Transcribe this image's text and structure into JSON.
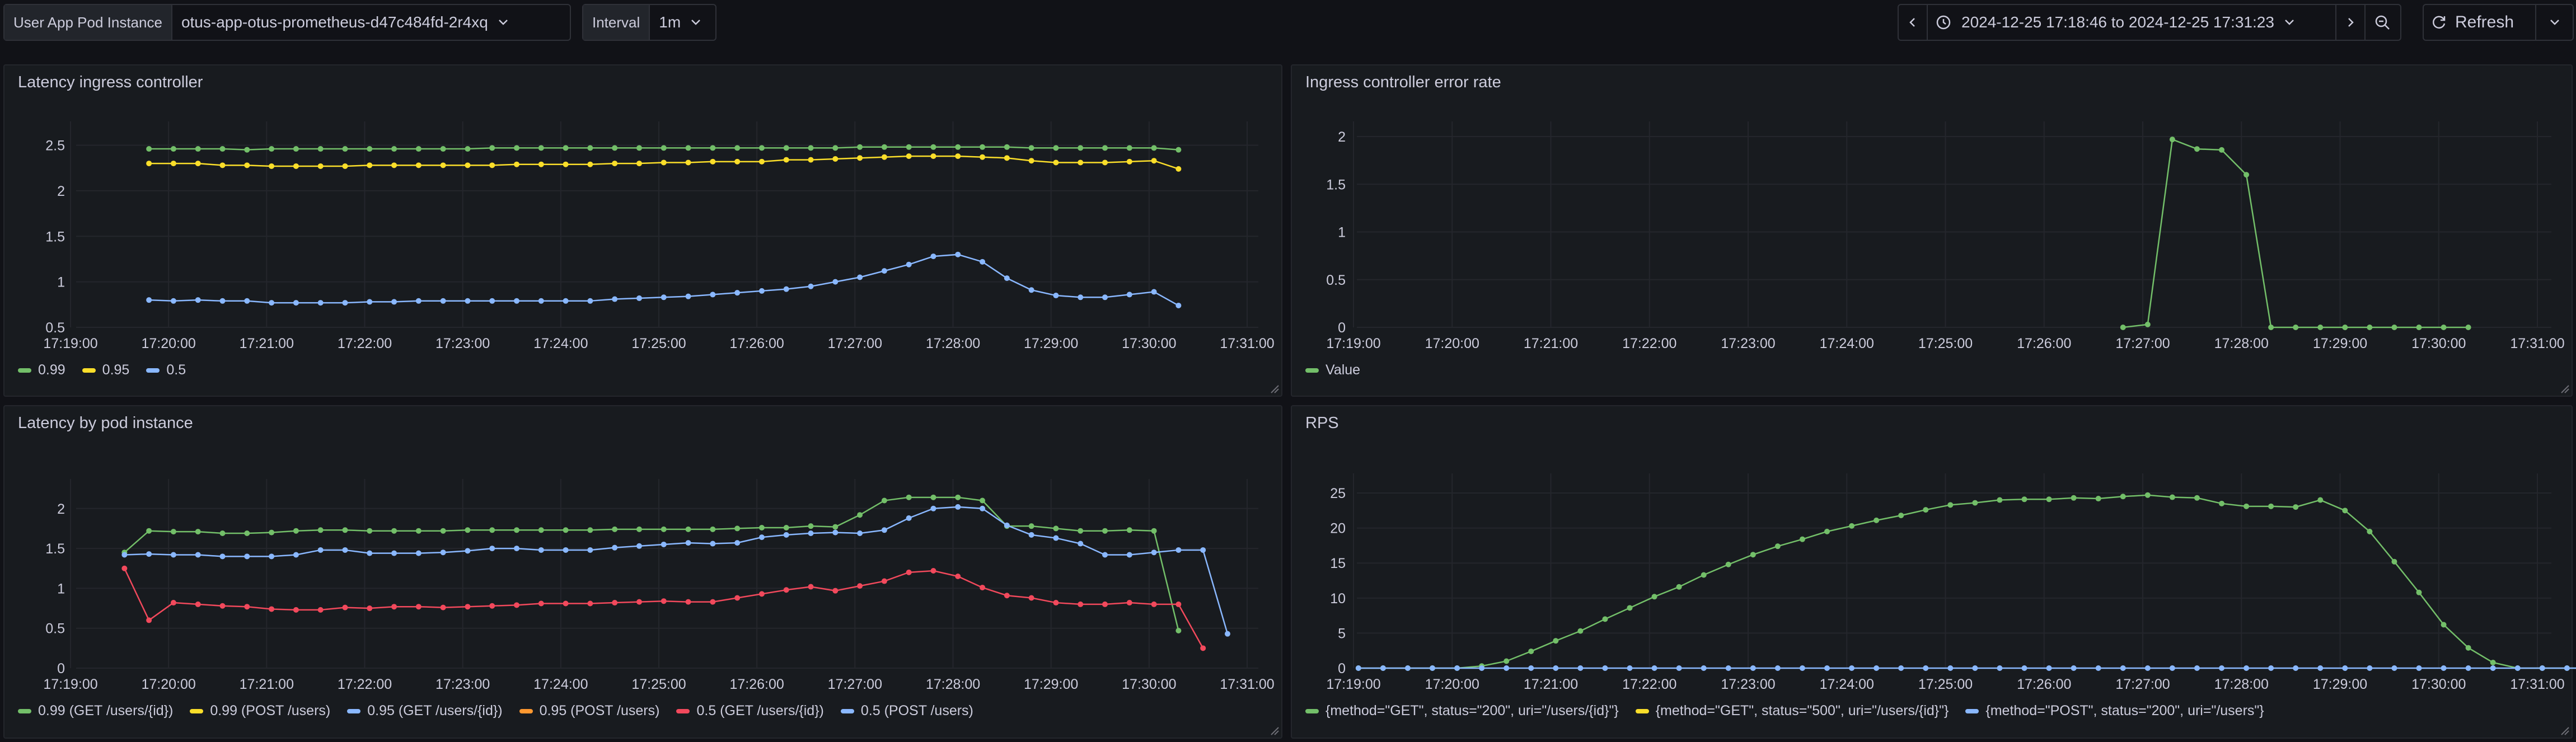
{
  "variables": {
    "pod_label": "User App Pod Instance",
    "pod_value": "otus-app-otus-prometheus-d47c484fd-2r4xq",
    "interval_label": "Interval",
    "interval_value": "1m"
  },
  "time_range": {
    "text": "2024-12-25 17:18:46 to 2024-12-25 17:31:23",
    "refresh_label": "Refresh"
  },
  "colors": {
    "green": "#73bf69",
    "yellow": "#fade2a",
    "blue": "#8ab8ff",
    "orange": "#ff9830",
    "red": "#f2495c"
  },
  "panels": {
    "latency_ingress": {
      "title": "Latency ingress controller"
    },
    "error_rate": {
      "title": "Ingress controller error rate"
    },
    "latency_pod": {
      "title": "Latency by pod instance"
    },
    "rps": {
      "title": "RPS"
    }
  },
  "chart_data": [
    {
      "type": "line",
      "title": "Latency ingress controller",
      "x_ticks": [
        "17:19:00",
        "17:20:00",
        "17:21:00",
        "17:22:00",
        "17:23:00",
        "17:24:00",
        "17:25:00",
        "17:26:00",
        "17:27:00",
        "17:28:00",
        "17:29:00",
        "17:30:00",
        "17:31:00"
      ],
      "y_ticks": [
        "0.5",
        "1",
        "1.5",
        "2",
        "2.5"
      ],
      "ylim": [
        0.5,
        2.7
      ],
      "x_start": "17:19:48",
      "x_step_seconds": 15,
      "series": [
        {
          "name": "0.99",
          "color": "#73bf69",
          "values": [
            2.46,
            2.46,
            2.46,
            2.46,
            2.45,
            2.46,
            2.46,
            2.46,
            2.46,
            2.46,
            2.46,
            2.46,
            2.46,
            2.46,
            2.47,
            2.47,
            2.47,
            2.47,
            2.47,
            2.47,
            2.47,
            2.47,
            2.47,
            2.47,
            2.47,
            2.47,
            2.47,
            2.47,
            2.47,
            2.48,
            2.48,
            2.48,
            2.48,
            2.48,
            2.48,
            2.48,
            2.47,
            2.47,
            2.47,
            2.47,
            2.47,
            2.47,
            2.45
          ]
        },
        {
          "name": "0.95",
          "color": "#fade2a",
          "values": [
            2.3,
            2.3,
            2.3,
            2.28,
            2.28,
            2.27,
            2.27,
            2.27,
            2.27,
            2.28,
            2.28,
            2.28,
            2.28,
            2.28,
            2.28,
            2.29,
            2.29,
            2.29,
            2.29,
            2.3,
            2.3,
            2.31,
            2.31,
            2.32,
            2.32,
            2.32,
            2.34,
            2.34,
            2.35,
            2.36,
            2.37,
            2.38,
            2.38,
            2.38,
            2.37,
            2.36,
            2.33,
            2.31,
            2.31,
            2.31,
            2.32,
            2.33,
            2.24
          ]
        },
        {
          "name": "0.5",
          "color": "#8ab8ff",
          "values": [
            0.8,
            0.79,
            0.8,
            0.79,
            0.79,
            0.77,
            0.77,
            0.77,
            0.77,
            0.78,
            0.78,
            0.79,
            0.79,
            0.79,
            0.79,
            0.79,
            0.79,
            0.79,
            0.79,
            0.81,
            0.82,
            0.83,
            0.84,
            0.86,
            0.88,
            0.9,
            0.92,
            0.95,
            1.0,
            1.05,
            1.12,
            1.19,
            1.28,
            1.3,
            1.22,
            1.04,
            0.91,
            0.85,
            0.83,
            0.83,
            0.86,
            0.89,
            0.74
          ]
        }
      ]
    },
    {
      "type": "line",
      "title": "Ingress controller error rate",
      "x_ticks": [
        "17:19:00",
        "17:20:00",
        "17:21:00",
        "17:22:00",
        "17:23:00",
        "17:24:00",
        "17:25:00",
        "17:26:00",
        "17:27:00",
        "17:28:00",
        "17:29:00",
        "17:30:00",
        "17:31:00"
      ],
      "y_ticks": [
        "0",
        "0.5",
        "1",
        "1.5",
        "2"
      ],
      "ylim": [
        0,
        2.1
      ],
      "x_start": "17:26:48",
      "x_step_seconds": 15,
      "series": [
        {
          "name": "Value",
          "color": "#73bf69",
          "values": [
            0,
            0.03,
            1.97,
            1.87,
            1.86,
            1.6,
            0,
            0,
            0,
            0,
            0,
            0,
            0,
            0,
            0
          ]
        }
      ]
    },
    {
      "type": "line",
      "title": "Latency by pod instance",
      "x_ticks": [
        "17:19:00",
        "17:20:00",
        "17:21:00",
        "17:22:00",
        "17:23:00",
        "17:24:00",
        "17:25:00",
        "17:26:00",
        "17:27:00",
        "17:28:00",
        "17:29:00",
        "17:30:00",
        "17:31:00"
      ],
      "y_ticks": [
        "0",
        "0.5",
        "1",
        "1.5",
        "2"
      ],
      "ylim": [
        0,
        2.3
      ],
      "x_start": "17:19:33",
      "x_step_seconds": 15,
      "series": [
        {
          "name": "0.99 (GET /users/{id})",
          "color": "#73bf69",
          "values": [
            1.45,
            1.72,
            1.71,
            1.71,
            1.69,
            1.69,
            1.7,
            1.72,
            1.73,
            1.73,
            1.72,
            1.72,
            1.72,
            1.72,
            1.73,
            1.73,
            1.73,
            1.73,
            1.73,
            1.73,
            1.74,
            1.74,
            1.74,
            1.74,
            1.74,
            1.75,
            1.76,
            1.76,
            1.78,
            1.77,
            1.92,
            2.1,
            2.14,
            2.14,
            2.14,
            2.1,
            1.78,
            1.78,
            1.75,
            1.72,
            1.72,
            1.73,
            1.72,
            0.47
          ]
        },
        {
          "name": "0.99 (POST /users)",
          "color": "#fade2a",
          "values": []
        },
        {
          "name": "0.95 (GET /users/{id})",
          "color": "#8ab8ff",
          "values": [
            1.42,
            1.43,
            1.42,
            1.42,
            1.4,
            1.4,
            1.4,
            1.42,
            1.48,
            1.48,
            1.44,
            1.44,
            1.44,
            1.45,
            1.47,
            1.5,
            1.5,
            1.48,
            1.48,
            1.48,
            1.51,
            1.53,
            1.55,
            1.57,
            1.56,
            1.57,
            1.64,
            1.67,
            1.69,
            1.7,
            1.69,
            1.73,
            1.88,
            2.0,
            2.02,
            2.0,
            1.79,
            1.67,
            1.63,
            1.56,
            1.42,
            1.42,
            1.45,
            1.48,
            1.48,
            0.43
          ]
        },
        {
          "name": "0.95 (POST /users)",
          "color": "#ff9830",
          "values": []
        },
        {
          "name": "0.5 (GET /users/{id})",
          "color": "#f2495c",
          "values": [
            1.25,
            0.6,
            0.82,
            0.8,
            0.78,
            0.77,
            0.74,
            0.73,
            0.73,
            0.76,
            0.75,
            0.77,
            0.77,
            0.76,
            0.77,
            0.78,
            0.79,
            0.81,
            0.81,
            0.81,
            0.82,
            0.83,
            0.84,
            0.83,
            0.83,
            0.88,
            0.93,
            0.98,
            1.02,
            0.97,
            1.03,
            1.09,
            1.2,
            1.22,
            1.15,
            1.01,
            0.91,
            0.88,
            0.82,
            0.8,
            0.8,
            0.82,
            0.8,
            0.8,
            0.25
          ]
        },
        {
          "name": "0.5 (POST /users)",
          "color": "#8ab8ff",
          "values": []
        }
      ]
    },
    {
      "type": "line",
      "title": "RPS",
      "x_ticks": [
        "17:19:00",
        "17:20:00",
        "17:21:00",
        "17:22:00",
        "17:23:00",
        "17:24:00",
        "17:25:00",
        "17:26:00",
        "17:27:00",
        "17:28:00",
        "17:29:00",
        "17:30:00",
        "17:31:00"
      ],
      "y_ticks": [
        "0",
        "5",
        "10",
        "15",
        "20",
        "25"
      ],
      "ylim": [
        0,
        27
      ],
      "x_start": "17:19:03",
      "x_step_seconds": 15,
      "series": [
        {
          "name": "{method=\"GET\", status=\"200\", uri=\"/users/{id}\"}",
          "color": "#73bf69",
          "values": [
            0,
            0,
            0,
            0,
            0,
            0.3,
            1.0,
            2.4,
            3.9,
            5.3,
            7.0,
            8.6,
            10.2,
            11.6,
            13.3,
            14.8,
            16.2,
            17.4,
            18.4,
            19.5,
            20.3,
            21.1,
            21.8,
            22.6,
            23.3,
            23.6,
            24.0,
            24.1,
            24.1,
            24.3,
            24.2,
            24.5,
            24.7,
            24.4,
            24.3,
            23.5,
            23.1,
            23.1,
            23.0,
            24.0,
            22.5,
            19.5,
            15.2,
            10.8,
            6.2,
            2.9,
            0.8,
            0,
            0,
            0,
            0,
            0,
            0
          ]
        },
        {
          "name": "{method=\"GET\", status=\"500\", uri=\"/users/{id}\"}",
          "color": "#fade2a",
          "values": []
        },
        {
          "name": "{method=\"POST\", status=\"200\", uri=\"/users\"}",
          "color": "#8ab8ff",
          "values": [
            0,
            0,
            0,
            0,
            0,
            0,
            0,
            0,
            0,
            0,
            0,
            0,
            0,
            0,
            0,
            0,
            0,
            0,
            0,
            0,
            0,
            0,
            0,
            0,
            0,
            0,
            0,
            0,
            0,
            0,
            0,
            0,
            0,
            0,
            0,
            0,
            0,
            0,
            0,
            0,
            0,
            0,
            0,
            0,
            0,
            0,
            0,
            0,
            0,
            0,
            0,
            0,
            0
          ]
        }
      ]
    }
  ]
}
